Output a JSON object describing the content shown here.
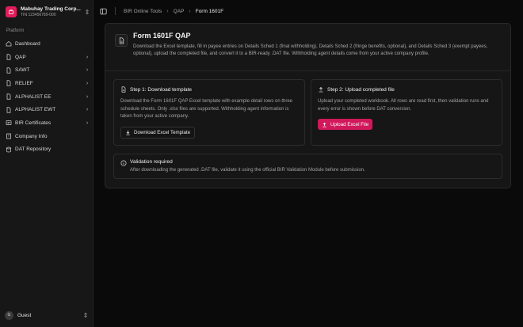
{
  "company": {
    "name": "Mabuhay Trading Corp...",
    "tin": "TIN 123456789-000"
  },
  "sidebar": {
    "section_label": "Platform",
    "items": [
      {
        "label": "Dashboard",
        "icon": "home-icon",
        "has_chevron": false
      },
      {
        "label": "QAP",
        "icon": "file-icon",
        "has_chevron": true
      },
      {
        "label": "SAWT",
        "icon": "file-icon",
        "has_chevron": true
      },
      {
        "label": "RELIEF",
        "icon": "file-icon",
        "has_chevron": true
      },
      {
        "label": "ALPHALIST EE",
        "icon": "file-icon",
        "has_chevron": true
      },
      {
        "label": "ALPHALIST EWT",
        "icon": "file-icon",
        "has_chevron": true
      },
      {
        "label": "BIR Certificates",
        "icon": "certificate-icon",
        "has_chevron": true
      },
      {
        "label": "Company Info",
        "icon": "building-icon",
        "has_chevron": false
      },
      {
        "label": "DAT Repository",
        "icon": "database-icon",
        "has_chevron": false
      }
    ]
  },
  "user": {
    "initial": "G",
    "name": "Guest"
  },
  "breadcrumb": {
    "items": [
      "BIR Online Tools",
      "QAP",
      "Form 1601F"
    ]
  },
  "page": {
    "title": "Form 1601F QAP",
    "description": "Download the Excel template, fill in payee entries on Details Sched 1 (final withholding), Details Sched 2 (fringe benefits, optional), and Details Sched 3 (exempt payees, optional), upload the completed file, and convert it to a BIR-ready .DAT file. Withholding agent details come from your active company profile."
  },
  "step1": {
    "title": "Step 1: Download template",
    "text": "Download the Form 1601F QAP Excel template with example detail rows on three schedule sheets. Only .xlsx files are supported. Withholding agent information is taken from your active company.",
    "button": "Download Excel Template"
  },
  "step2": {
    "title": "Step 2: Upload completed file",
    "text": "Upload your completed workbook. All rows are read first, then validation runs and every error is shown before DAT conversion.",
    "button": "Upload Excel File"
  },
  "validation": {
    "title": "Validation required",
    "text": "After downloading the generated .DAT file, validate it using the official BIR Validation Module before submission."
  },
  "colors": {
    "accent": "#d0185a",
    "logo": "#e11d5b",
    "background": "#0a0a0a",
    "sidebar": "#171717"
  }
}
